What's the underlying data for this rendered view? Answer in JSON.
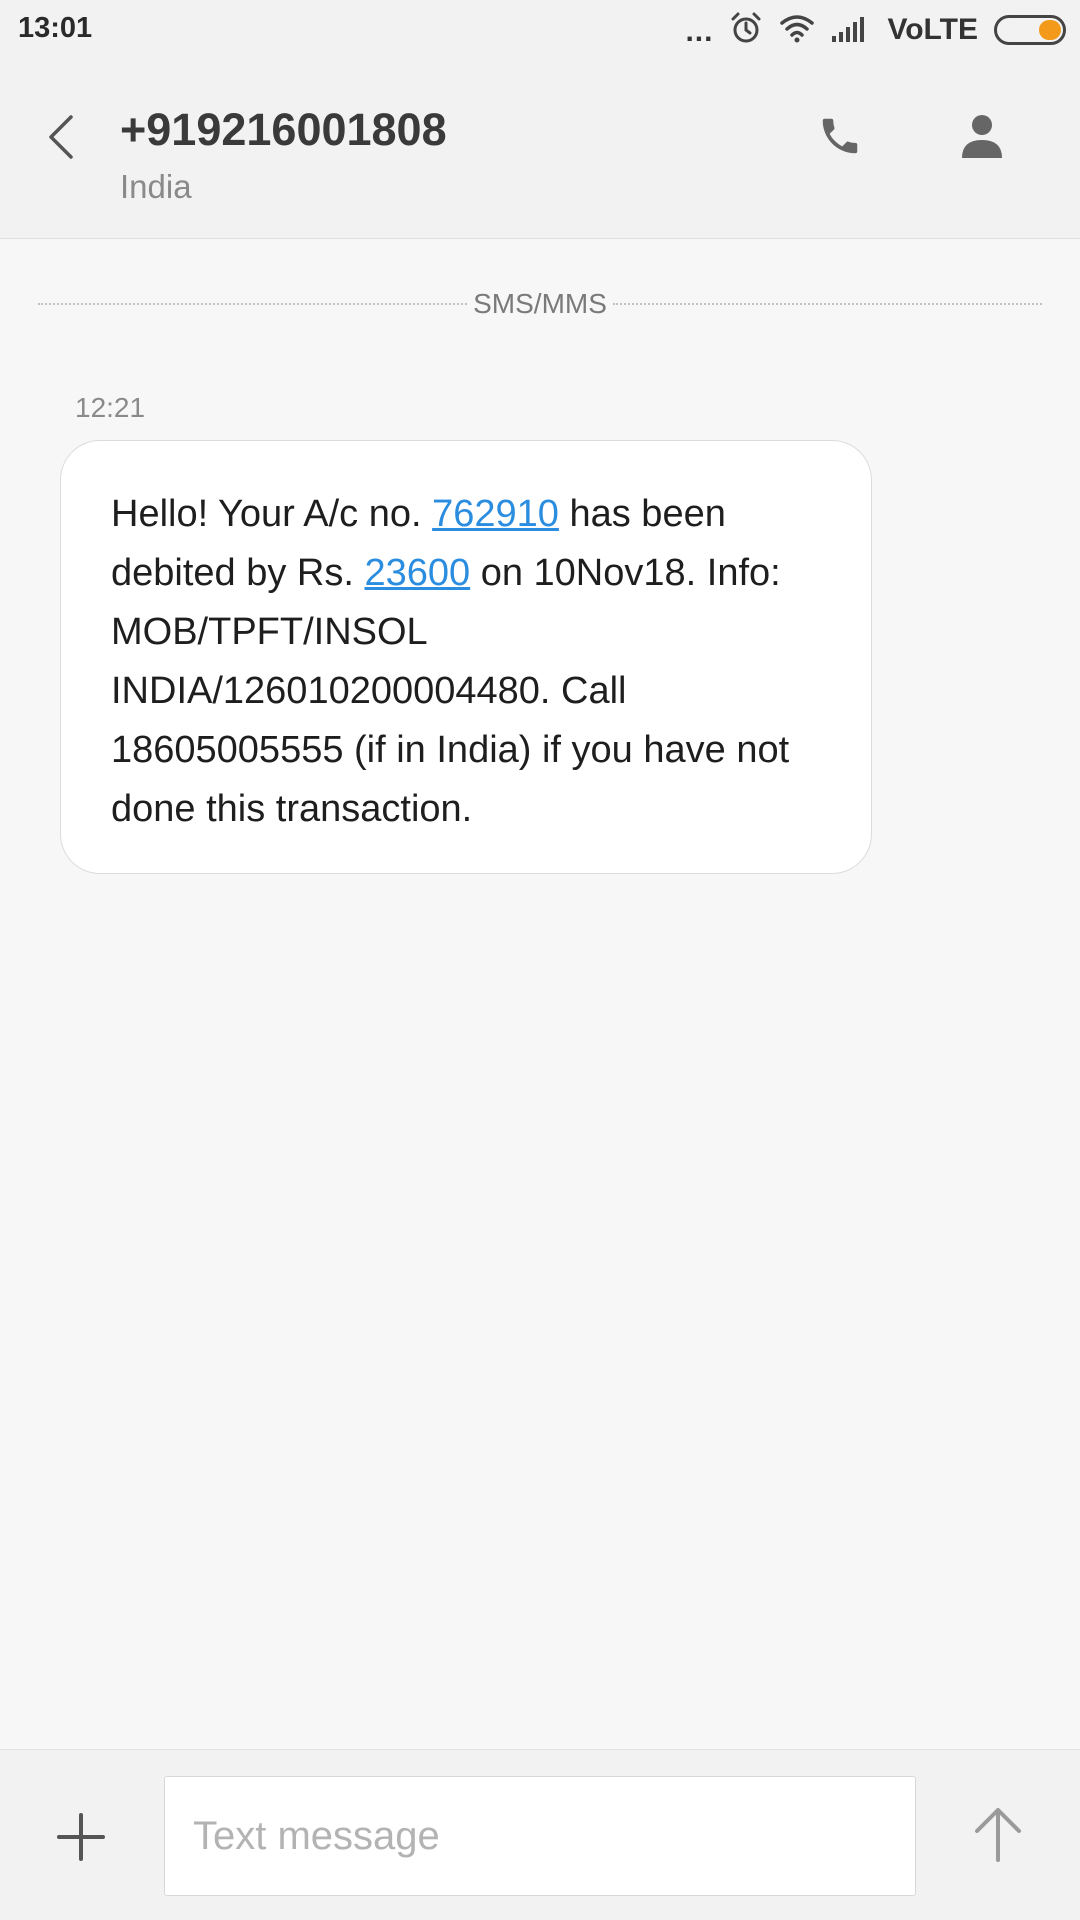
{
  "status_bar": {
    "time": "13:01",
    "dots": "...",
    "network_label": "VoLTE",
    "icons": [
      "alarm-icon",
      "wifi-icon",
      "signal-icon",
      "battery-icon"
    ],
    "battery_color": "#f39a1b"
  },
  "header": {
    "title": "+919216001808",
    "subtitle": "India",
    "icons": [
      "back-arrow-icon",
      "phone-icon",
      "person-icon"
    ]
  },
  "thread": {
    "divider_label": "SMS/MMS",
    "messages": [
      {
        "time": "12:21",
        "segments": {
          "t1": "Hello! Your A/c no. ",
          "link1": "762910",
          "t2": " has been debited by Rs. ",
          "link2": "23600",
          "t3": " on 10Nov18. Info: MOB/TPFT/INSOL INDIA/126010200004480. Call 18605005555 (if in India) if you have not done this transaction."
        }
      }
    ]
  },
  "composer": {
    "placeholder": "Text message",
    "value": "",
    "icons": [
      "plus-icon",
      "send-arrow-icon"
    ]
  },
  "colors": {
    "link": "#2a8de0",
    "background": "#f7f7f7",
    "bar": "#f2f2f2"
  }
}
